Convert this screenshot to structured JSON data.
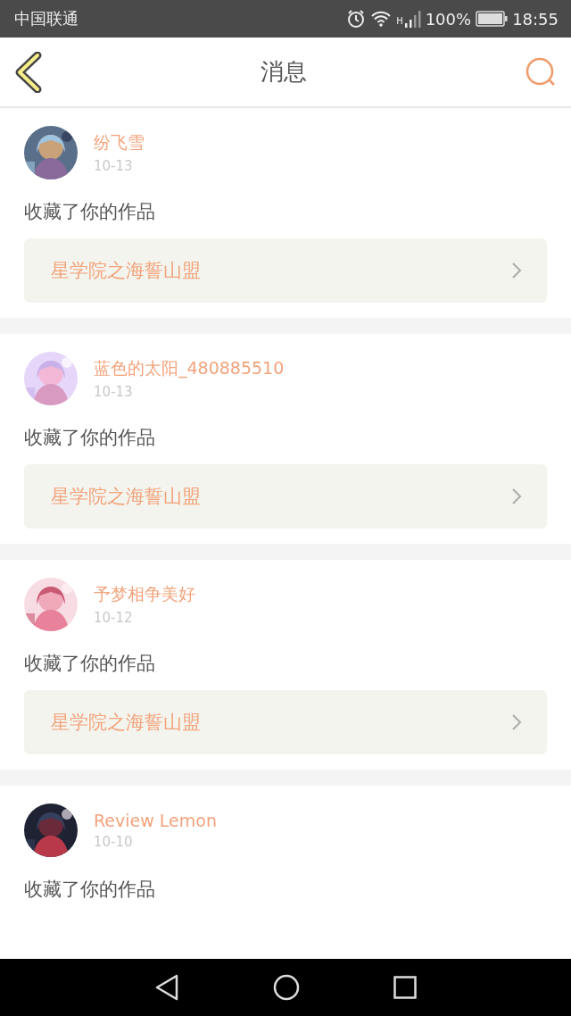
{
  "status_bar": {
    "carrier": "中国联通",
    "network": "H",
    "battery": "100%",
    "time": "18:55"
  },
  "header": {
    "title": "消息"
  },
  "messages": [
    {
      "user": "纷飞雪",
      "date": "10-13",
      "action": "收藏了你的作品",
      "work": "星学院之海誓山盟"
    },
    {
      "user": "蓝色的太阳_480885510",
      "date": "10-13",
      "action": "收藏了你的作品",
      "work": "星学院之海誓山盟"
    },
    {
      "user": "予梦相争美好",
      "date": "10-12",
      "action": "收藏了你的作品",
      "work": "星学院之海誓山盟"
    },
    {
      "user": "Review Lemon",
      "date": "10-10",
      "action": "收藏了你的作品"
    }
  ]
}
